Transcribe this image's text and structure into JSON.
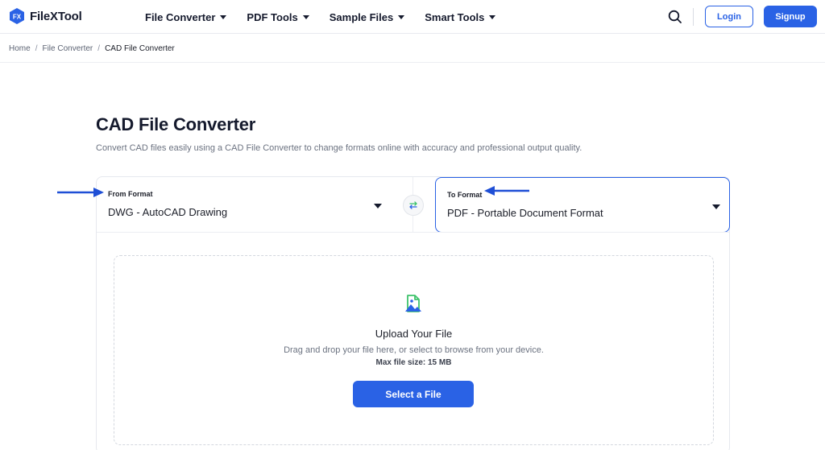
{
  "brand": {
    "logo_mark": "FX",
    "name": "FileXTool"
  },
  "nav": {
    "items": [
      {
        "label": "File Converter"
      },
      {
        "label": "PDF Tools"
      },
      {
        "label": "Sample Files"
      },
      {
        "label": "Smart Tools"
      }
    ],
    "login_label": "Login",
    "signup_label": "Signup"
  },
  "breadcrumb": {
    "items": [
      "Home",
      "File Converter"
    ],
    "current": "CAD File Converter",
    "separator": "/"
  },
  "page": {
    "title": "CAD File Converter",
    "subtitle": "Convert CAD files easily using a CAD File Converter to change formats online with accuracy and professional output quality."
  },
  "converter": {
    "from_label": "From Format",
    "from_value": "DWG - AutoCAD Drawing",
    "to_label": "To Format",
    "to_value": "PDF - Portable Document Format"
  },
  "upload": {
    "title": "Upload Your File",
    "description": "Drag and drop your file here, or select to browse from your device.",
    "max_size": "Max file size: 15 MB",
    "button_label": "Select a File"
  },
  "colors": {
    "accent": "#2a62e5",
    "annotation_arrow": "#1f4fd6",
    "icon_green": "#3ec26b"
  },
  "icons": [
    "logo-hexagon-icon",
    "search-icon",
    "swap-arrows-icon",
    "file-image-upload-icon",
    "arrow-annotation-icon"
  ]
}
